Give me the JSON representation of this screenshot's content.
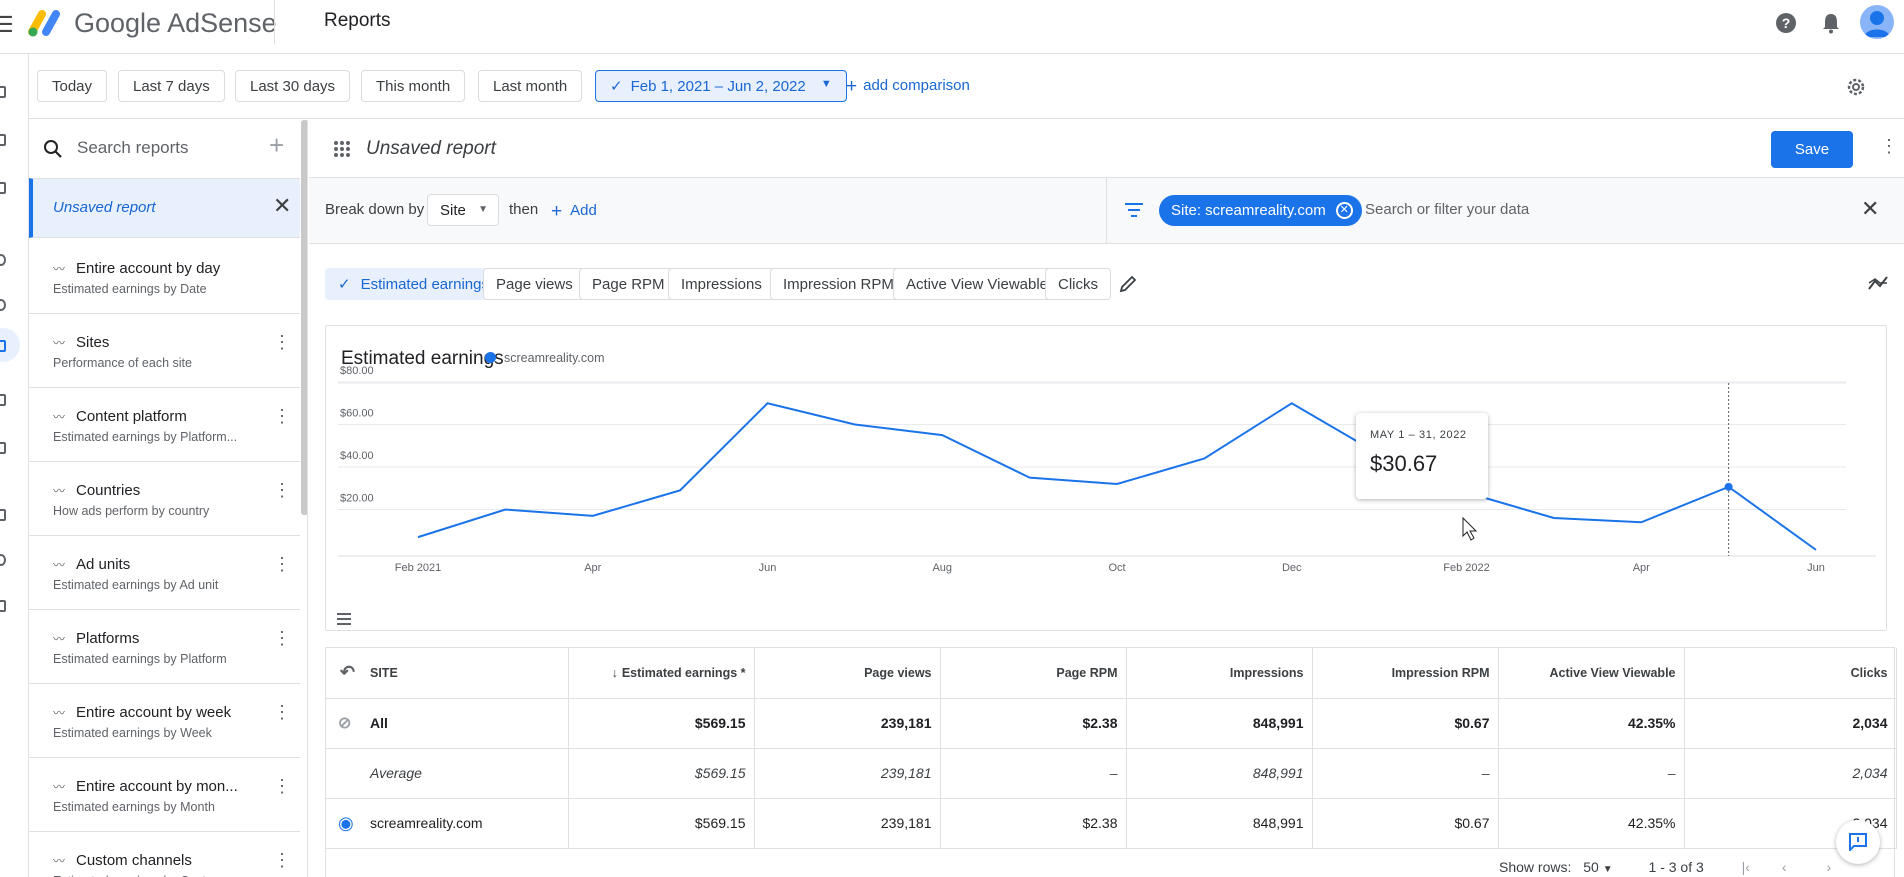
{
  "header": {
    "brand": "Google AdSense",
    "page_title": "Reports"
  },
  "date_bar": {
    "presets": [
      "Today",
      "Last 7 days",
      "Last 30 days",
      "This month",
      "Last month"
    ],
    "selected_range": "Feb 1, 2021 – Jun 2, 2022",
    "add_comparison": "add comparison"
  },
  "sidebar": {
    "search_placeholder": "Search reports",
    "unsaved_label": "Unsaved report",
    "items": [
      {
        "title": "Entire account by day",
        "subtitle": "Estimated earnings by Date"
      },
      {
        "title": "Sites",
        "subtitle": "Performance of each site"
      },
      {
        "title": "Content platform",
        "subtitle": "Estimated earnings by Platform..."
      },
      {
        "title": "Countries",
        "subtitle": "How ads perform by country"
      },
      {
        "title": "Ad units",
        "subtitle": "Estimated earnings by Ad unit"
      },
      {
        "title": "Platforms",
        "subtitle": "Estimated earnings by Platform"
      },
      {
        "title": "Entire account by week",
        "subtitle": "Estimated earnings by Week"
      },
      {
        "title": "Entire account by mon...",
        "subtitle": "Estimated earnings by Month"
      },
      {
        "title": "Custom channels",
        "subtitle": "Estimated earnings by Custom..."
      }
    ]
  },
  "report": {
    "title": "Unsaved report",
    "save_label": "Save",
    "breakdown_label": "Break down by",
    "breakdown_value": "Site",
    "then_label": "then",
    "add_label": "Add",
    "filter_chip": "Site: screamreality.com",
    "filter_placeholder": "Search or filter your data",
    "metrics": [
      "Estimated earnings",
      "Page views",
      "Page RPM",
      "Impressions",
      "Impression RPM",
      "Active View Viewable",
      "Clicks"
    ]
  },
  "chart_data": {
    "type": "line",
    "title": "Estimated earnings",
    "x": [
      "Feb 2021",
      "Mar 2021",
      "Apr 2021",
      "May 2021",
      "Jun 2021",
      "Jul 2021",
      "Aug 2021",
      "Sep 2021",
      "Oct 2021",
      "Nov 2021",
      "Dec 2021",
      "Jan 2022",
      "Feb 2022",
      "Mar 2022",
      "Apr 2022",
      "May 2022",
      "Jun 2022"
    ],
    "x_tick_labels": [
      "Feb 2021",
      "Apr",
      "Jun",
      "Aug",
      "Oct",
      "Dec",
      "Feb 2022",
      "Apr",
      "Jun"
    ],
    "x_tick_index": [
      0,
      2,
      4,
      6,
      8,
      10,
      12,
      14,
      16
    ],
    "series": [
      {
        "name": "screamreality.com",
        "color": "#1a73e8",
        "values": [
          7,
          20,
          17,
          29,
          70,
          60,
          55,
          35,
          32,
          44,
          70,
          46,
          28,
          16,
          14,
          30.67,
          1
        ]
      }
    ],
    "y_ticks": [
      "$20.00",
      "$40.00",
      "$60.00",
      "$80.00"
    ],
    "y_tick_values": [
      20,
      40,
      60,
      80
    ],
    "ylim": [
      0,
      80
    ],
    "grid": true,
    "highlight_index": 15,
    "tooltip": {
      "label": "MAY 1 – 31, 2022",
      "value": "$30.67"
    }
  },
  "table": {
    "headers": [
      "SITE",
      "Estimated earnings *",
      "Page views",
      "Page RPM",
      "Impressions",
      "Impression RPM",
      "Active View Viewable",
      "Clicks"
    ],
    "rows": [
      {
        "site": "All",
        "values": [
          "$569.15",
          "239,181",
          "$2.38",
          "848,991",
          "$0.67",
          "42.35%",
          "2,034"
        ]
      },
      {
        "site": "Average",
        "values": [
          "$569.15",
          "239,181",
          "–",
          "848,991",
          "–",
          "–",
          "2,034"
        ]
      },
      {
        "site": "screamreality.com",
        "values": [
          "$569.15",
          "239,181",
          "$2.38",
          "848,991",
          "$0.67",
          "42.35%",
          "2,034"
        ]
      }
    ],
    "show_rows_label": "Show rows:",
    "show_rows_value": "50",
    "range_label": "1 - 3 of 3"
  }
}
